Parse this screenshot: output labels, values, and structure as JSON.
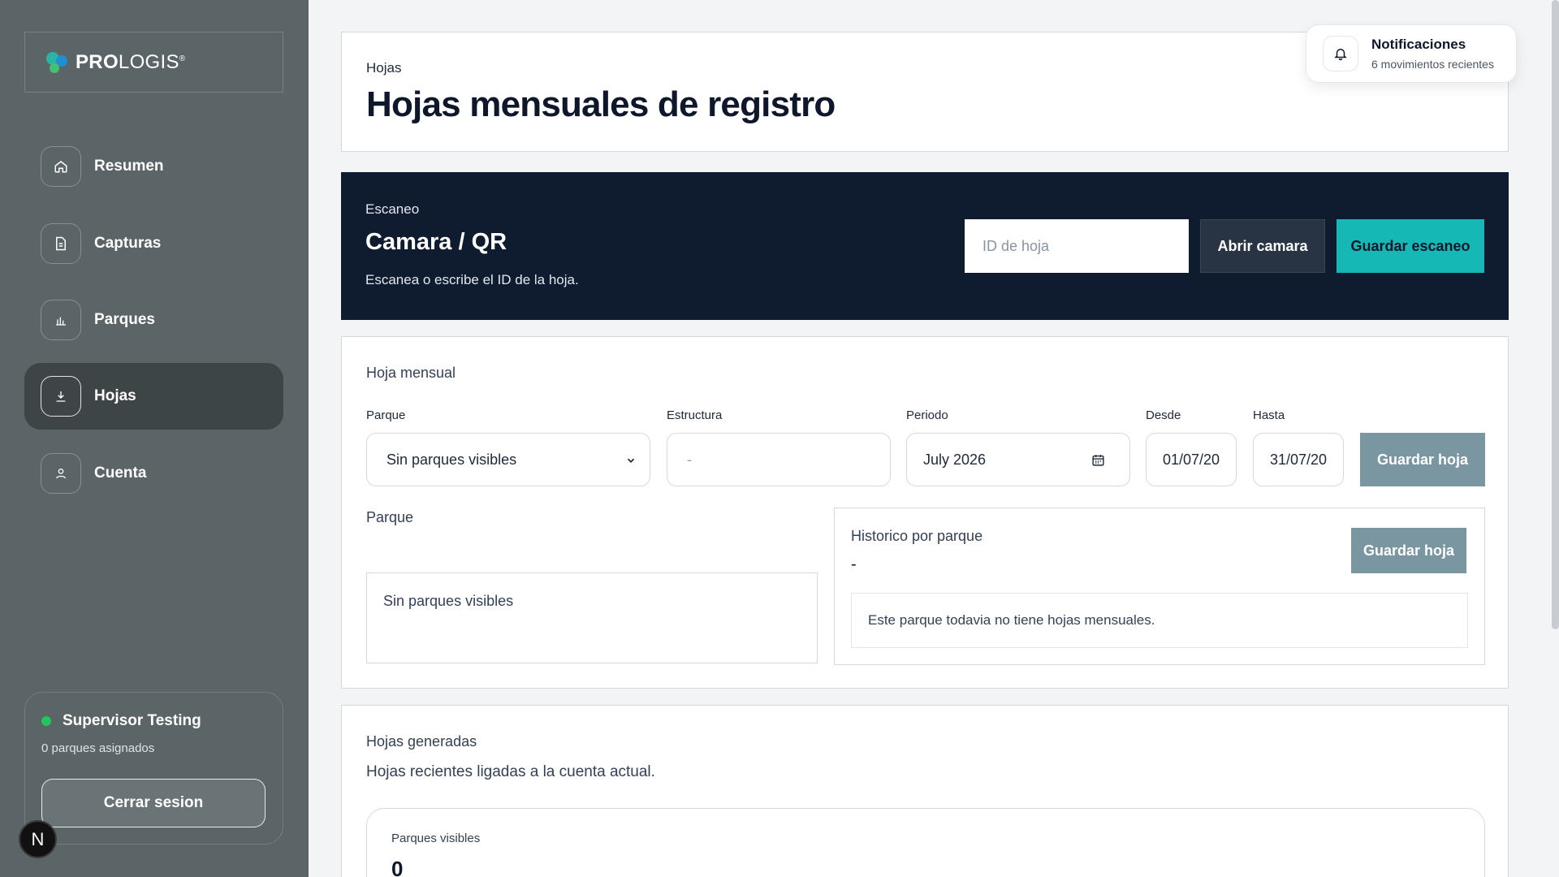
{
  "brand": {
    "name_bold": "PRO",
    "name_rest": "LOGIS",
    "mark": "®"
  },
  "sidebar": {
    "items": [
      {
        "label": "Resumen",
        "icon": "home-icon"
      },
      {
        "label": "Capturas",
        "icon": "document-icon"
      },
      {
        "label": "Parques",
        "icon": "bar-chart-icon"
      },
      {
        "label": "Hojas",
        "icon": "download-icon",
        "active": true
      },
      {
        "label": "Cuenta",
        "icon": "user-icon"
      }
    ],
    "user": {
      "name": "Supervisor Testing",
      "subtitle": "0 parques asignados",
      "logout_label": "Cerrar sesion"
    },
    "framework_badge": "N"
  },
  "header": {
    "breadcrumb": "Hojas",
    "title": "Hojas mensuales de registro"
  },
  "notifications": {
    "title": "Notificaciones",
    "subtitle": "6 movimientos recientes"
  },
  "scan": {
    "kicker": "Escaneo",
    "title": "Camara / QR",
    "description": "Escanea o escribe el ID de la hoja.",
    "input_placeholder": "ID de hoja",
    "open_camera_label": "Abrir camara",
    "save_scan_label": "Guardar escaneo"
  },
  "monthly_sheet": {
    "section_title": "Hoja mensual",
    "fields": {
      "park": {
        "label": "Parque",
        "value": "Sin parques visibles"
      },
      "structure": {
        "label": "Estructura",
        "value": "-"
      },
      "period": {
        "label": "Periodo",
        "value": "July 2026"
      },
      "from": {
        "label": "Desde",
        "value": "01/07/20"
      },
      "to": {
        "label": "Hasta",
        "value": "31/07/20"
      }
    },
    "save_label": "Guardar hoja",
    "park_section_label": "Parque",
    "park_empty": "Sin parques visibles",
    "history": {
      "title": "Historico por parque",
      "value": "-",
      "save_label": "Guardar hoja",
      "empty": "Este parque todavia no tiene hojas mensuales."
    }
  },
  "generated": {
    "title": "Hojas generadas",
    "description": "Hojas recientes ligadas a la cuenta actual.",
    "stat_label": "Parques visibles",
    "stat_value": "0"
  },
  "colors": {
    "sidebar": "#5b6466",
    "scan_bg": "#0f1b2e",
    "accent": "#16b8b5",
    "status_online": "#22c55e"
  }
}
